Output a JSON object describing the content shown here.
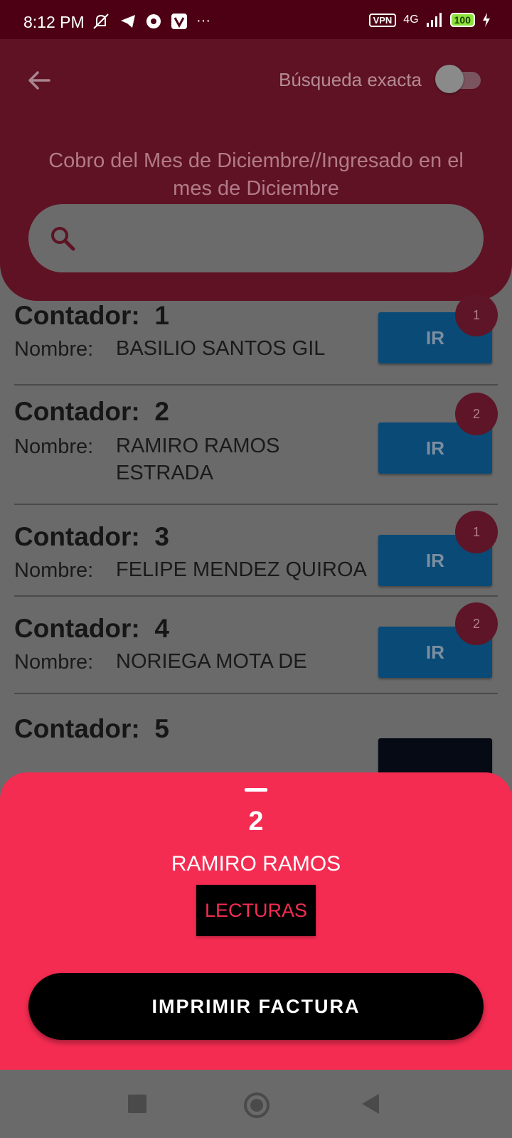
{
  "status_bar": {
    "time": "8:12 PM",
    "more": "···",
    "vpn": "VPN",
    "network": "4G",
    "battery": "100"
  },
  "header": {
    "exact_search_label": "Búsqueda exacta",
    "exact_search_on": false,
    "subtitle": "Cobro del Mes de Diciembre//Ingresado en el mes de Diciembre",
    "search": {
      "value": "",
      "placeholder": ""
    }
  },
  "list": {
    "contador_label": "Contador:",
    "nombre_label": "Nombre:",
    "items": [
      {
        "number": "1",
        "name": "BASILIO SANTOS GIL",
        "badge": "1",
        "button": "IR"
      },
      {
        "number": "2",
        "name": "RAMIRO RAMOS ESTRADA",
        "badge": "2",
        "button": "IR"
      },
      {
        "number": "3",
        "name": "FELIPE MENDEZ QUIROA",
        "badge": "1",
        "button": "IR"
      },
      {
        "number": "4",
        "name": "NORIEGA MOTA DE",
        "badge": "2",
        "button": "IR"
      },
      {
        "number": "5"
      }
    ]
  },
  "sheet": {
    "number": "2",
    "name": "RAMIRO RAMOS",
    "lecturas_label": "LECTURAS",
    "print_label": "IMPRIMIR FACTURA"
  },
  "colors": {
    "header": "#5f1223",
    "sheet": "#f52c52",
    "ir_button": "#0a4a77",
    "status_bar": "#4d0014"
  }
}
